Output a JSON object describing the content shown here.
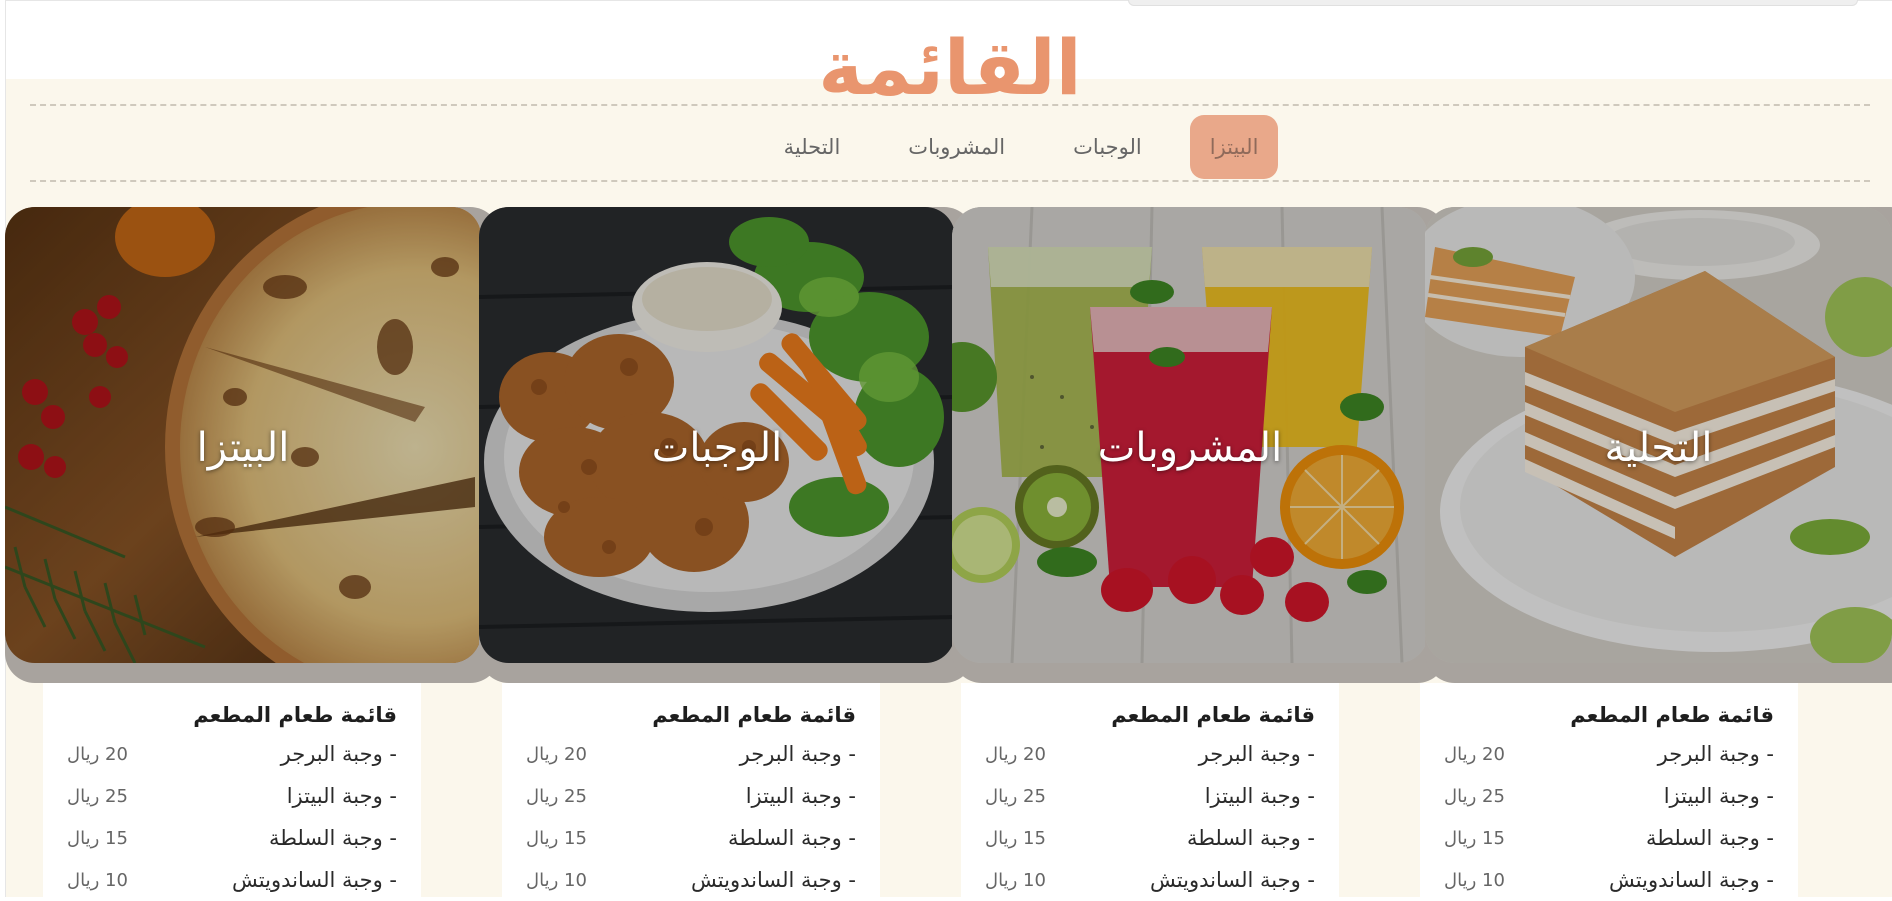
{
  "page_title": "القائمة",
  "tabs": [
    {
      "label": "البيتزا",
      "active": true
    },
    {
      "label": "الوجبات",
      "active": false
    },
    {
      "label": "المشروبات",
      "active": false
    },
    {
      "label": "التحلية",
      "active": false
    }
  ],
  "cards": [
    {
      "label": "البيتزا",
      "image": "pizza-photo"
    },
    {
      "label": "الوجبات",
      "image": "fried-chicken-photo"
    },
    {
      "label": "المشروبات",
      "image": "juices-photo"
    },
    {
      "label": "التحلية",
      "image": "cake-photo"
    }
  ],
  "menus": [
    {
      "title": "قائمة طعام المطعم",
      "items": [
        {
          "name": "- وجبة البرجر",
          "price": "20 ريال"
        },
        {
          "name": "- وجبة البيتزا",
          "price": "25 ريال"
        },
        {
          "name": "- وجبة السلطة",
          "price": "15 ريال"
        },
        {
          "name": "- وجبة الساندويتش",
          "price": "10 ريال"
        }
      ]
    },
    {
      "title": "قائمة طعام المطعم",
      "items": [
        {
          "name": "- وجبة البرجر",
          "price": "20 ريال"
        },
        {
          "name": "- وجبة البيتزا",
          "price": "25 ريال"
        },
        {
          "name": "- وجبة السلطة",
          "price": "15 ريال"
        },
        {
          "name": "- وجبة الساندويتش",
          "price": "10 ريال"
        }
      ]
    },
    {
      "title": "قائمة طعام المطعم",
      "items": [
        {
          "name": "- وجبة البرجر",
          "price": "20 ريال"
        },
        {
          "name": "- وجبة البيتزا",
          "price": "25 ريال"
        },
        {
          "name": "- وجبة السلطة",
          "price": "15 ريال"
        },
        {
          "name": "- وجبة الساندويتش",
          "price": "10 ريال"
        }
      ]
    },
    {
      "title": "قائمة طعام المطعم",
      "items": [
        {
          "name": "- وجبة البرجر",
          "price": "20 ريال"
        },
        {
          "name": "- وجبة البيتزا",
          "price": "25 ريال"
        },
        {
          "name": "- وجبة السلطة",
          "price": "15 ريال"
        },
        {
          "name": "- وجبة الساندويتش",
          "price": "10 ريال"
        }
      ]
    }
  ],
  "colors": {
    "accent": "#e9956e",
    "active_tab": "#e9a88a",
    "background": "#fbf7ec"
  }
}
